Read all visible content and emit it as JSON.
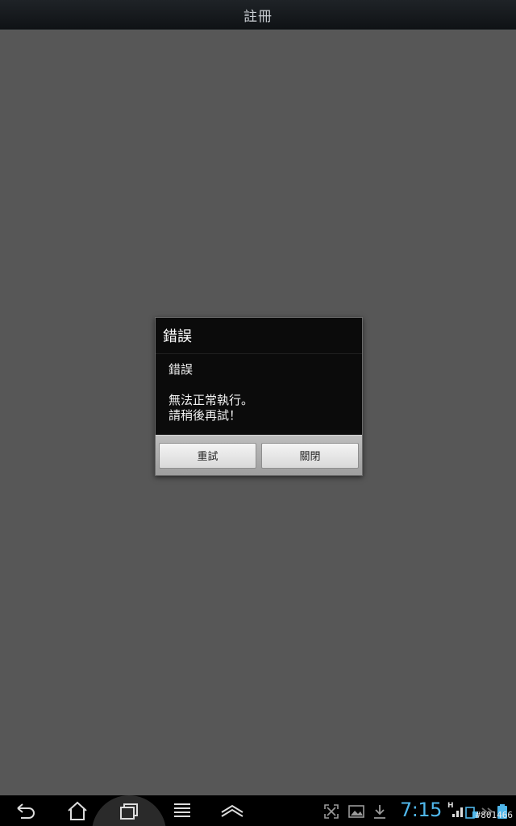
{
  "header": {
    "title": "註冊"
  },
  "dialog": {
    "title": "錯誤",
    "message_title": "錯誤",
    "message_line1": "無法正常執行。",
    "message_line2": "請稍後再試！",
    "retry_label": "重試",
    "close_label": "關閉"
  },
  "statusbar": {
    "time": "7:15",
    "network_label": "H",
    "time_color": "#4fb6ea"
  },
  "navbar": {
    "icons": [
      "back-icon",
      "home-icon",
      "recent-apps-icon",
      "menu-icon",
      "hide-keyboard-icon"
    ]
  },
  "watermark": "#801466"
}
